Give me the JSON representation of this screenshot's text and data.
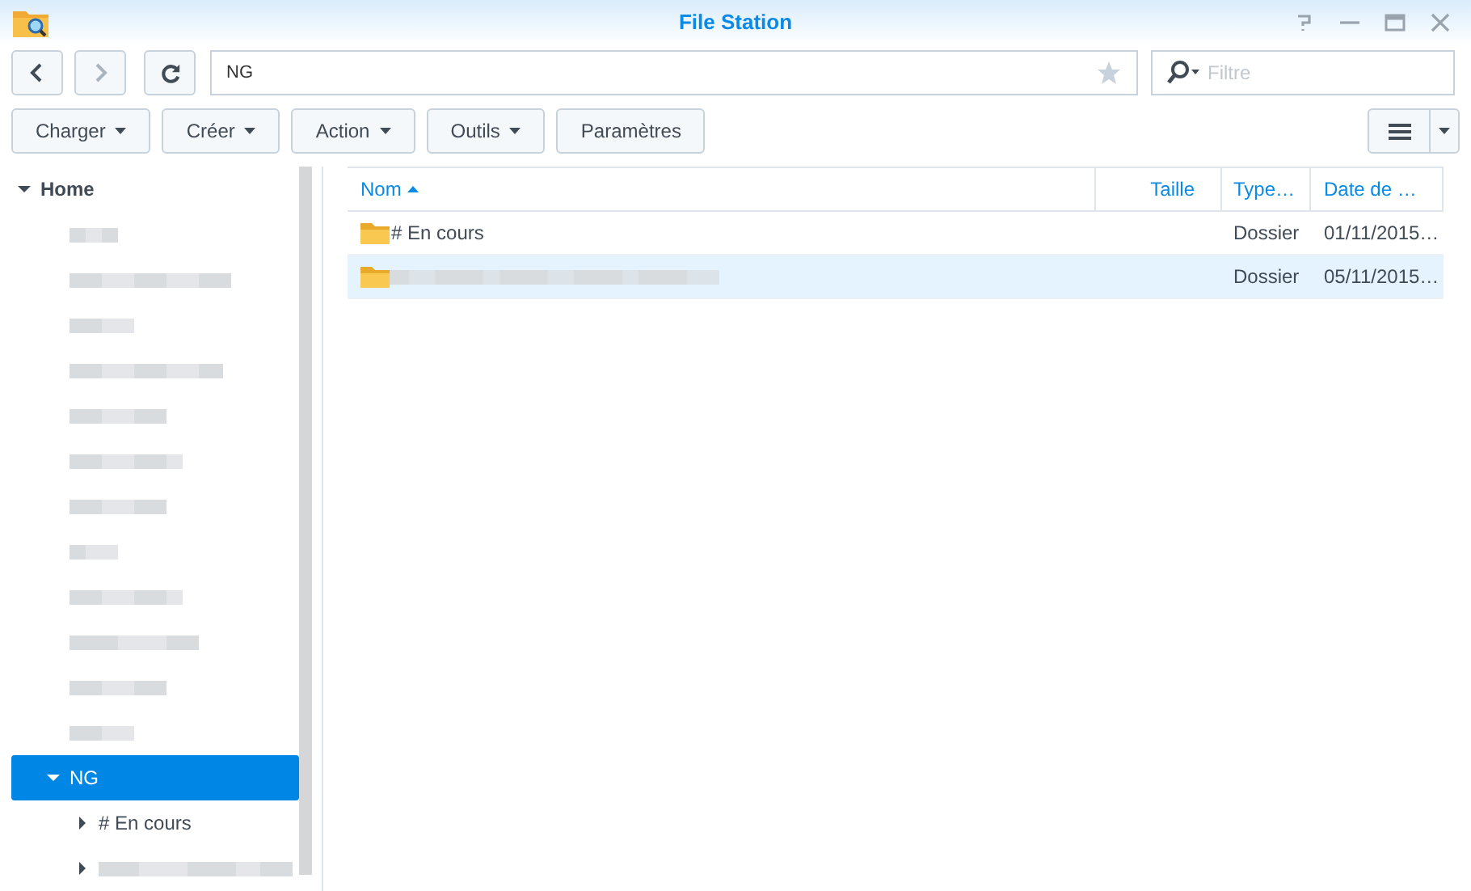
{
  "window": {
    "title": "File Station"
  },
  "path_field": {
    "value": "NG",
    "favorite": false
  },
  "filter_field": {
    "placeholder": "Filtre"
  },
  "toolbar": [
    {
      "label": "Charger",
      "dropdown": true
    },
    {
      "label": "Créer",
      "dropdown": true
    },
    {
      "label": "Action",
      "dropdown": true
    },
    {
      "label": "Outils",
      "dropdown": true
    },
    {
      "label": "Paramètres",
      "dropdown": false
    }
  ],
  "tree": [
    {
      "label": "Home",
      "expanded": true,
      "selected": false,
      "children": [
        {
          "kind": "blurred",
          "selected": false
        },
        {
          "kind": "blurred",
          "selected": false
        },
        {
          "kind": "blurred",
          "selected": false
        },
        {
          "kind": "blurred",
          "selected": false
        },
        {
          "kind": "blurred",
          "selected": false
        },
        {
          "kind": "blurred",
          "selected": false
        },
        {
          "kind": "blurred",
          "selected": false
        },
        {
          "kind": "blurred",
          "selected": false
        },
        {
          "kind": "blurred",
          "selected": false
        },
        {
          "kind": "blurred",
          "selected": false
        },
        {
          "kind": "blurred",
          "selected": false
        },
        {
          "kind": "blurred",
          "selected": false
        },
        {
          "label": "NG",
          "expanded": true,
          "selected": true,
          "children": [
            {
              "label": "# En cours",
              "expanded": false,
              "selected": false
            },
            {
              "kind": "blurred",
              "expanded": false,
              "selected": false
            }
          ]
        }
      ]
    }
  ],
  "table": {
    "columns": [
      {
        "label": "Nom",
        "sorted": true
      },
      {
        "label": "Taille",
        "sorted": false
      },
      {
        "label": "Type…",
        "sorted": false
      },
      {
        "label": "Date de …",
        "sorted": false
      }
    ],
    "rows": [
      {
        "name": "# En cours",
        "type": "Dossier",
        "date": "01/11/2015…",
        "selected": false
      },
      {
        "kind": "blurred",
        "type": "Dossier",
        "date": "05/11/2015…",
        "selected": true
      }
    ]
  }
}
